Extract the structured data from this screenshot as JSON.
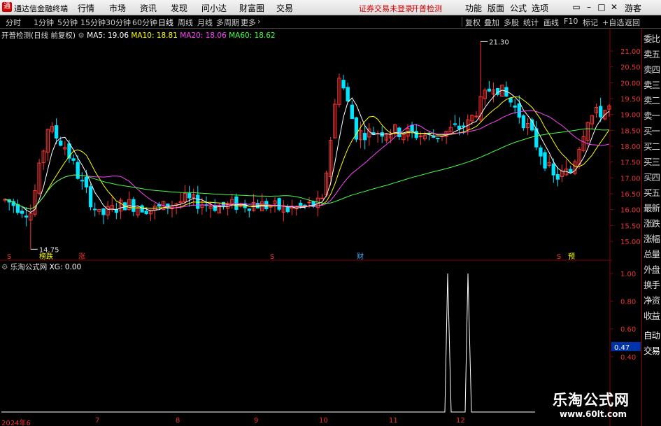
{
  "app": {
    "logo_char": "通",
    "title": "通达信金融终端",
    "menus": [
      "行情",
      "市场",
      "资讯",
      "发现",
      "问小达",
      "财富圈",
      "交易"
    ],
    "status_texts": [
      "证券交易未登录",
      "开普检测"
    ],
    "right_menus": [
      "功能",
      "版面",
      "公式",
      "选项"
    ],
    "user": "游客"
  },
  "toolbar": {
    "periods": [
      "分时",
      "1分钟",
      "5分钟",
      "15分钟",
      "30分钟",
      "60分钟",
      "日线",
      "周线",
      "月线",
      "多周期",
      "更多"
    ],
    "active_period": "日线",
    "tools": [
      "复权",
      "叠加",
      "多股",
      "统计",
      "画线",
      "F10",
      "标记",
      "+自选",
      "返回"
    ]
  },
  "main_chart": {
    "header": "开普检测(日线 前复权)",
    "ma": [
      {
        "label": "MA5: 19.06",
        "color": "#ffffff"
      },
      {
        "label": "MA10: 18.81",
        "color": "#ffff00"
      },
      {
        "label": "MA20: 18.06",
        "color": "#ff44ff"
      },
      {
        "label": "MA60: 18.62",
        "color": "#44ff44"
      }
    ],
    "high_label": "21.30",
    "low_label": "14.75",
    "price_ticks": [
      "21.00",
      "20.50",
      "20.00",
      "19.50",
      "19.00",
      "18.50",
      "18.00",
      "17.50",
      "17.00",
      "16.50",
      "16.00",
      "15.50",
      "15.00"
    ],
    "markers": [
      "S",
      "榜跌",
      "涨",
      "S",
      "财",
      "S",
      "预"
    ]
  },
  "sub_chart": {
    "header": "乐淘公式网",
    "xg": "XG: 0.00",
    "ticks": [
      "1.00",
      "0.80",
      "0.60",
      "0.40"
    ],
    "current_value": "0.47"
  },
  "date_axis": [
    "2024年6",
    "7",
    "8",
    "9",
    "10",
    "11",
    "12"
  ],
  "right_panel": [
    "委比",
    "卖五",
    "卖四",
    "卖三",
    "卖二",
    "卖一",
    "买一",
    "买二",
    "买三",
    "买四",
    "买五",
    "最新",
    "涨跌",
    "涨幅",
    "总量",
    "外盘",
    "换手",
    "净资",
    "收益",
    "自动",
    "交易"
  ],
  "watermark": {
    "cn": "乐淘公式网",
    "url": "www.60lt.com"
  },
  "colors": {
    "up": "#ff3333",
    "down": "#00e5ff",
    "ma5": "#ffffff",
    "ma10": "#ffff00",
    "ma20": "#ff44ff",
    "ma60": "#44ff44"
  }
}
